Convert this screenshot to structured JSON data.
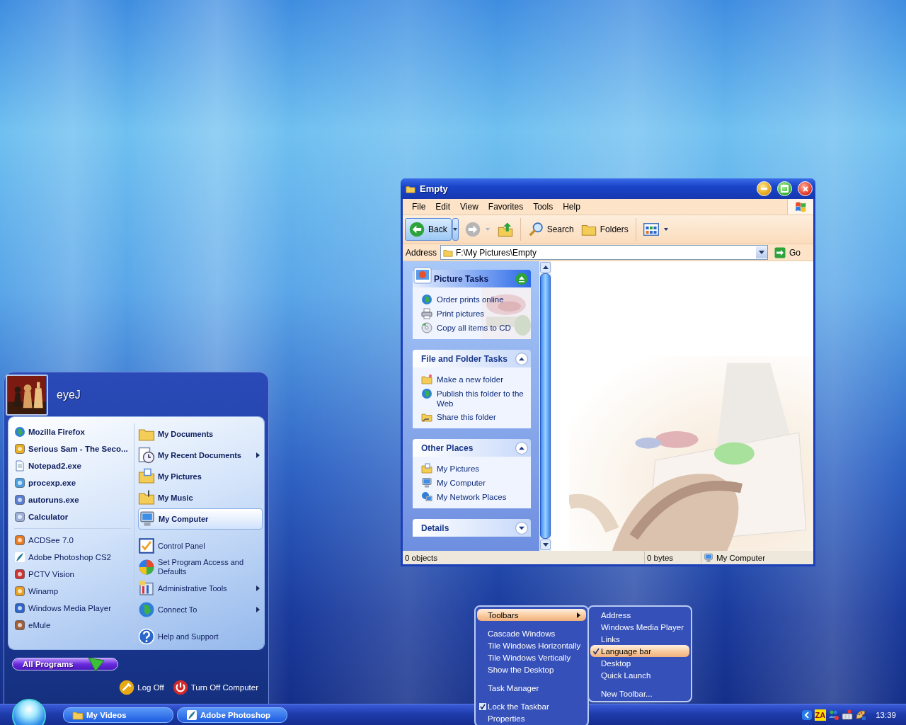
{
  "explorer": {
    "title": "Empty",
    "menu": [
      "File",
      "Edit",
      "View",
      "Favorites",
      "Tools",
      "Help"
    ],
    "toolbar": [
      {
        "kind": "back",
        "label": "Back"
      },
      {
        "kind": "forward"
      },
      {
        "kind": "up"
      },
      {
        "kind": "search",
        "label": "Search"
      },
      {
        "kind": "folders",
        "label": "Folders"
      },
      {
        "kind": "views"
      }
    ],
    "address": {
      "label": "Address",
      "value": "F:\\My Pictures\\Empty",
      "go": "Go"
    },
    "task_panes": [
      {
        "kind": "special",
        "title": "Picture Tasks",
        "expanded": true,
        "items": [
          "Order prints online",
          "Print pictures",
          "Copy all items to CD"
        ]
      },
      {
        "kind": "normal",
        "title": "File and Folder Tasks",
        "expanded": true,
        "items": [
          "Make a new folder",
          "Publish this folder to the Web",
          "Share this folder"
        ]
      },
      {
        "kind": "normal",
        "title": "Other Places",
        "expanded": true,
        "items": [
          "My Pictures",
          "My Computer",
          "My Network Places"
        ]
      },
      {
        "kind": "normal",
        "title": "Details",
        "expanded": false
      }
    ],
    "status_bar": [
      "0 objects",
      "0 bytes",
      "My Computer"
    ]
  },
  "start_menu": {
    "user": "eyeJ",
    "pinned": [
      "Mozilla Firefox",
      "Serious Sam - The Seco...",
      "Notepad2.exe",
      "procexp.exe",
      "autoruns.exe",
      "Calculator"
    ],
    "recent": [
      "ACDSee 7.0",
      "Adobe Photoshop CS2",
      "PCTV Vision",
      "Winamp",
      "Windows Media Player",
      "eMule"
    ],
    "places": [
      {
        "label": "My Documents",
        "selected": false,
        "submenu": false
      },
      {
        "label": "My Recent Documents",
        "selected": false,
        "submenu": true
      },
      {
        "label": "My Pictures",
        "selected": false,
        "submenu": false
      },
      {
        "label": "My Music",
        "selected": false,
        "submenu": false
      },
      {
        "label": "My Computer",
        "selected": true,
        "submenu": false
      }
    ],
    "system": [
      {
        "label": "Control Panel",
        "submenu": false
      },
      {
        "label": "Set Program Access and Defaults",
        "submenu": false
      },
      {
        "label": "Administrative Tools",
        "submenu": true
      },
      {
        "label": "Connect To",
        "submenu": true
      }
    ],
    "help": "Help and Support",
    "all_programs": "All Programs",
    "log_off": "Log Off",
    "turn_off": "Turn Off Computer"
  },
  "context_menu": {
    "groups": [
      [
        {
          "label": "Toolbars",
          "selected": true,
          "checked": false,
          "submenu": true
        }
      ],
      [
        {
          "label": "Cascade Windows",
          "selected": false,
          "checked": false,
          "submenu": false
        },
        {
          "label": "Tile Windows Horizontally",
          "selected": false,
          "checked": false,
          "submenu": false
        },
        {
          "label": "Tile Windows Vertically",
          "selected": false,
          "checked": false,
          "submenu": false
        },
        {
          "label": "Show the Desktop",
          "selected": false,
          "checked": false,
          "submenu": false
        }
      ],
      [
        {
          "label": "Task Manager",
          "selected": false,
          "checked": false,
          "submenu": false
        }
      ],
      [
        {
          "label": "Lock the Taskbar",
          "selected": false,
          "checked": true,
          "submenu": false
        },
        {
          "label": "Properties",
          "selected": false,
          "checked": false,
          "submenu": false
        }
      ]
    ]
  },
  "toolbars_submenu": {
    "groups": [
      [
        {
          "label": "Address",
          "selected": false,
          "checked": false
        },
        {
          "label": "Windows Media Player",
          "selected": false,
          "checked": false
        },
        {
          "label": "Links",
          "selected": false,
          "checked": false
        },
        {
          "label": "Language bar",
          "selected": true,
          "checked": true
        },
        {
          "label": "Desktop",
          "selected": false,
          "checked": false
        },
        {
          "label": "Quick Launch",
          "selected": false,
          "checked": false
        }
      ],
      [
        {
          "label": "New Toolbar...",
          "selected": false,
          "checked": false
        }
      ]
    ]
  },
  "taskbar": {
    "tasks": [
      {
        "label": "My Videos",
        "kind": "folder"
      },
      {
        "label": "Adobe Photoshop",
        "kind": "feather"
      }
    ],
    "tray_badge": "ZA",
    "clock": "13:39"
  }
}
